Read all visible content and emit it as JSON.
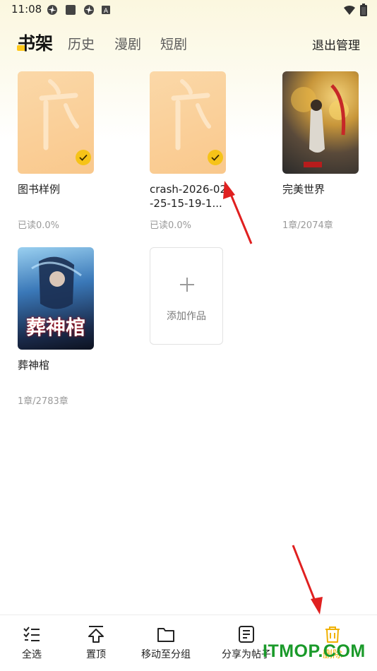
{
  "status_bar": {
    "time": "11:08"
  },
  "tabs": [
    {
      "label": "书架",
      "active": true
    },
    {
      "label": "历史"
    },
    {
      "label": "漫剧"
    },
    {
      "label": "短剧"
    }
  ],
  "header": {
    "exit_manage_label": "退出管理"
  },
  "books": [
    {
      "title": "图书样例",
      "progress": "已读0.0%",
      "selected": true,
      "cover": "default"
    },
    {
      "title": "crash-2026-02-25-15-19-1...",
      "progress": "已读0.0%",
      "selected": true,
      "cover": "default"
    },
    {
      "title": "完美世界",
      "progress": "1章/2074章",
      "selected": false,
      "cover": "art-gold"
    },
    {
      "title": "葬神棺",
      "progress": "1章/2783章",
      "selected": false,
      "cover": "art-blue",
      "cover_text": "葬神棺"
    }
  ],
  "add_card": {
    "label": "添加作品"
  },
  "toolbar": {
    "select_all": "全选",
    "pin_top": "置顶",
    "move_to_group": "移动至分组",
    "share_as_post": "分享为帖子",
    "delete": "删除"
  },
  "watermark": "ITMOP.COM",
  "colors": {
    "accent": "#ffc81a",
    "check": "#f6c318",
    "delete": "#f0b100",
    "arrow": "#e02020"
  }
}
